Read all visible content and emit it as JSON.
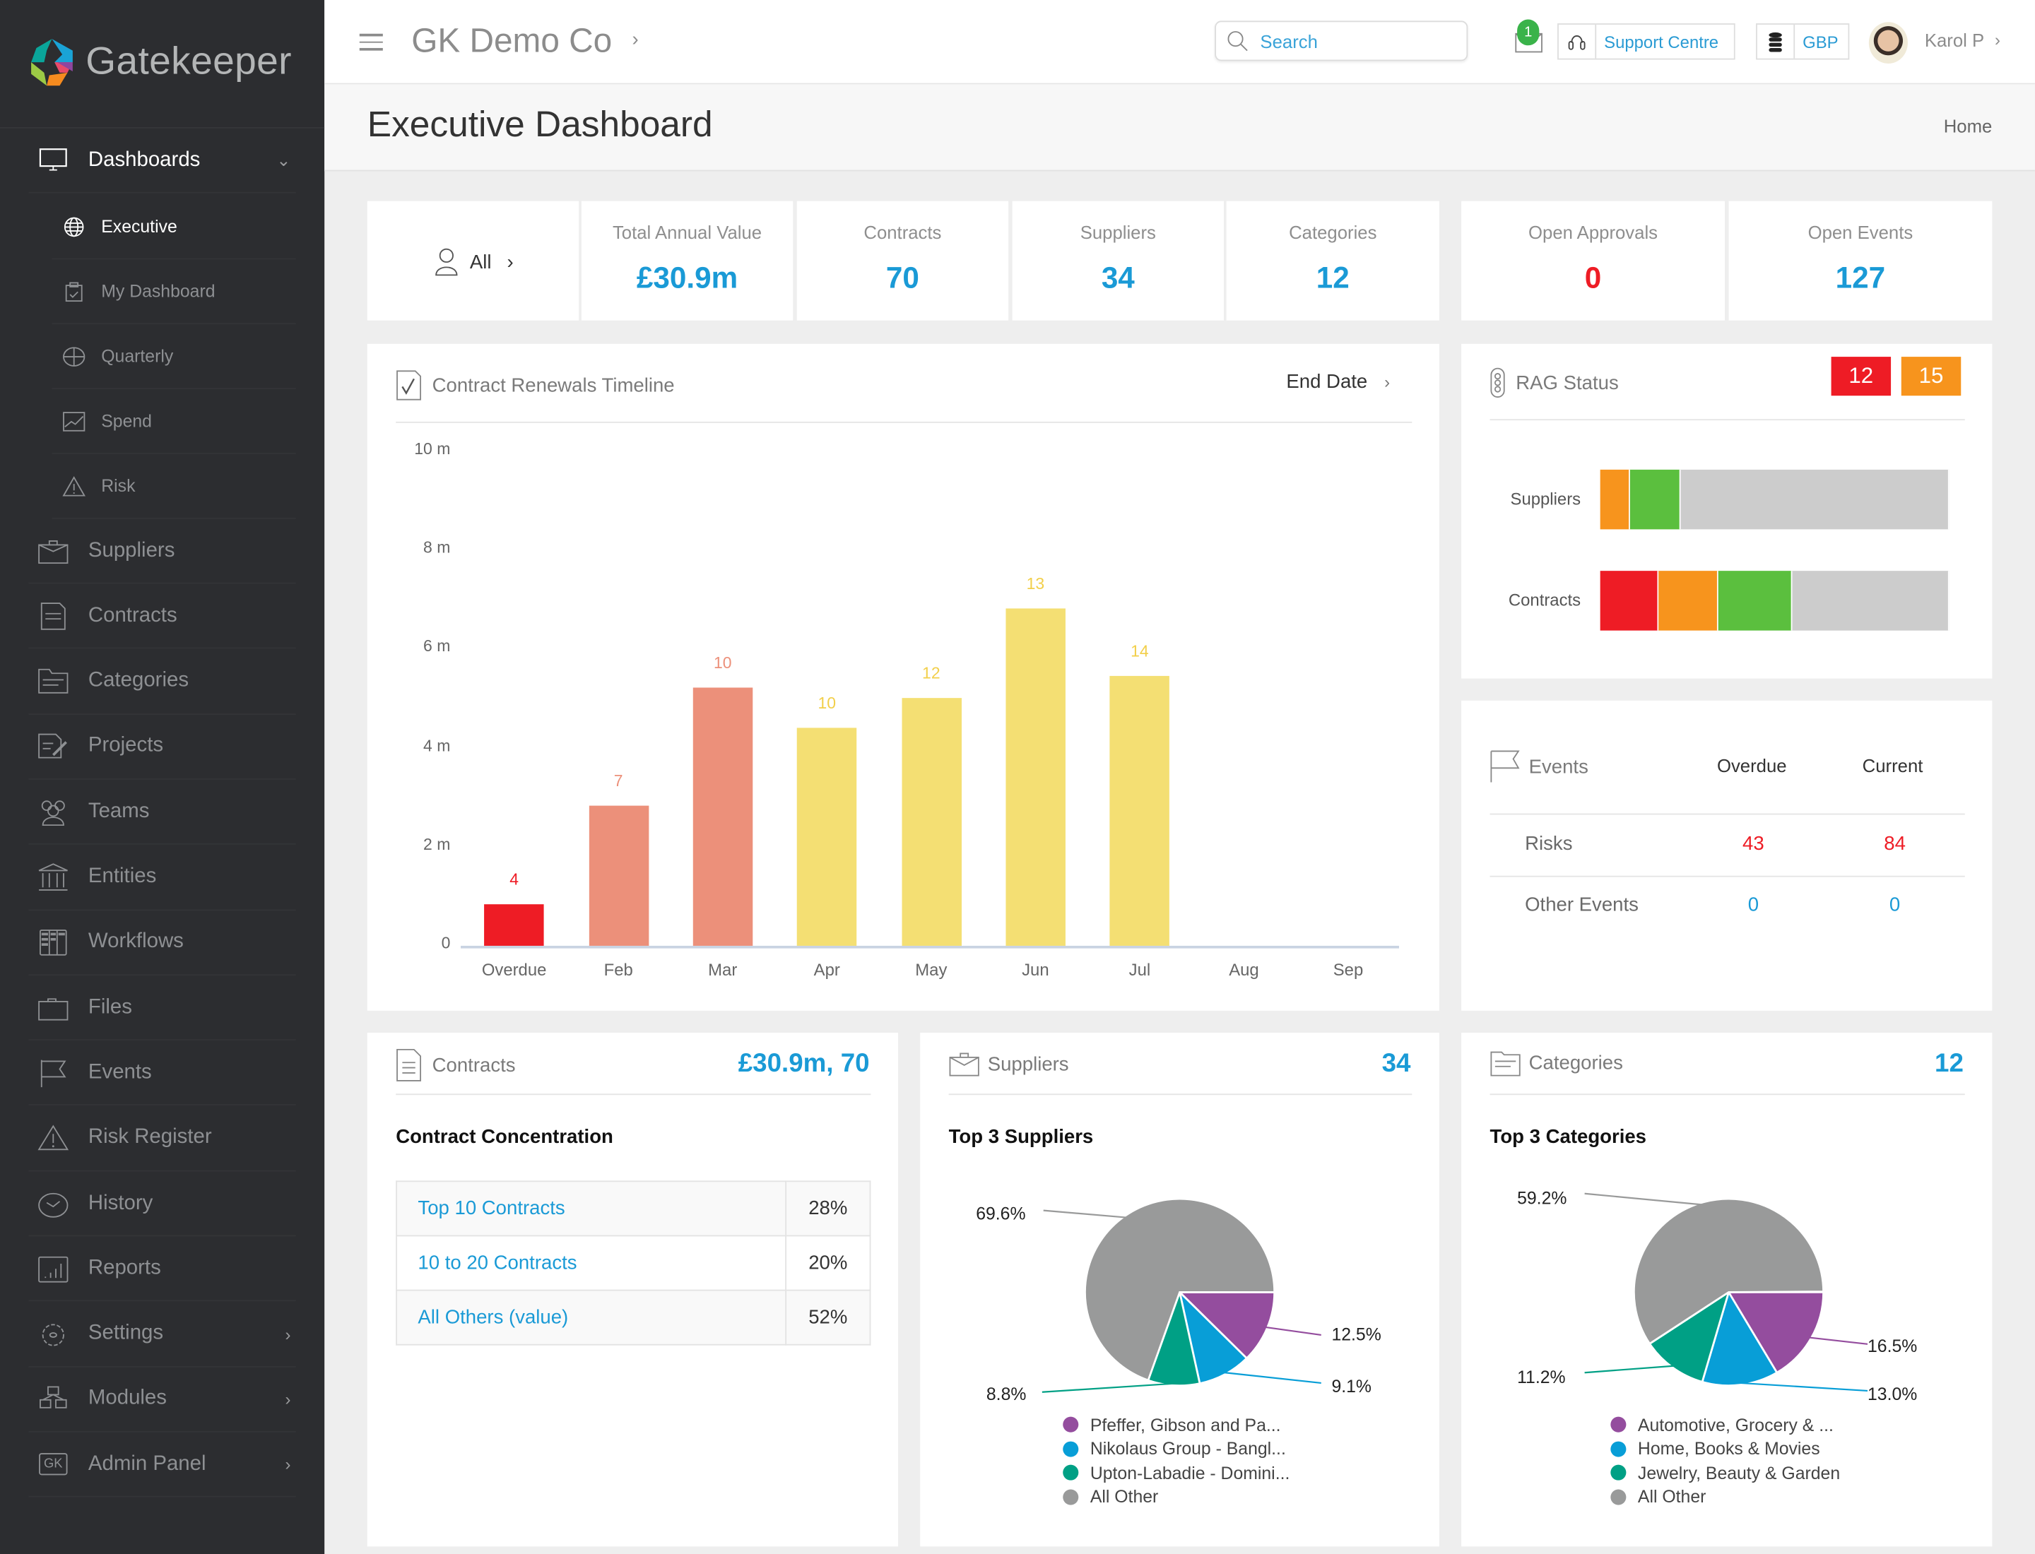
{
  "app": {
    "name": "Gatekeeper"
  },
  "sidebar": {
    "top_item": {
      "label": "Dashboards",
      "icon": "monitor-icon",
      "expanded": true
    },
    "sub_items": [
      {
        "label": "Executive",
        "icon": "globe-icon",
        "active": true
      },
      {
        "label": "My Dashboard",
        "icon": "clipboard-icon"
      },
      {
        "label": "Quarterly",
        "icon": "crosshair-icon"
      },
      {
        "label": "Spend",
        "icon": "trend-chart-icon"
      },
      {
        "label": "Risk",
        "icon": "warning-icon"
      }
    ],
    "items": [
      {
        "label": "Suppliers",
        "icon": "briefcase-icon"
      },
      {
        "label": "Contracts",
        "icon": "document-icon"
      },
      {
        "label": "Categories",
        "icon": "folder-tree-icon"
      },
      {
        "label": "Projects",
        "icon": "edit-document-icon"
      },
      {
        "label": "Teams",
        "icon": "people-icon"
      },
      {
        "label": "Entities",
        "icon": "bank-icon"
      },
      {
        "label": "Workflows",
        "icon": "kanban-icon"
      },
      {
        "label": "Files",
        "icon": "folder-icon"
      },
      {
        "label": "Events",
        "icon": "flag-icon"
      },
      {
        "label": "Risk Register",
        "icon": "warning-icon"
      },
      {
        "label": "History",
        "icon": "clock-icon"
      },
      {
        "label": "Reports",
        "icon": "bar-chart-icon"
      },
      {
        "label": "Settings",
        "icon": "gear-icon",
        "has_submenu": true
      },
      {
        "label": "Modules",
        "icon": "cubes-icon",
        "has_submenu": true
      },
      {
        "label": "Admin Panel",
        "icon": "gk-icon",
        "has_submenu": true,
        "icon_text": "GK"
      }
    ]
  },
  "topbar": {
    "company": "GK Demo Co",
    "search_placeholder": "Search",
    "mail_count": "1",
    "support_label": "Support Centre",
    "currency_label": "GBP",
    "user_name": "Karol P"
  },
  "page": {
    "title": "Executive Dashboard",
    "breadcrumb": "Home"
  },
  "kpis": {
    "filter_label": "All",
    "items": [
      {
        "label": "Total Annual Value",
        "value": "£30.9m"
      },
      {
        "label": "Contracts",
        "value": "70"
      },
      {
        "label": "Suppliers",
        "value": "34"
      },
      {
        "label": "Categories",
        "value": "12"
      },
      {
        "label": "Open Approvals",
        "value": "0",
        "color": "#ee1c25"
      },
      {
        "label": "Open Events",
        "value": "127"
      }
    ]
  },
  "renewals": {
    "title": "Contract Renewals Timeline",
    "sort_label": "End Date"
  },
  "chart_data": {
    "type": "bar",
    "title": "Contract Renewals Timeline",
    "xlabel": "",
    "ylabel": "",
    "ylim": [
      0,
      10
    ],
    "y_ticks": [
      0,
      2,
      4,
      6,
      8,
      10
    ],
    "y_tick_labels": [
      "0",
      "2 m",
      "4 m",
      "6 m",
      "8 m",
      "10 m"
    ],
    "categories": [
      "Overdue",
      "Feb",
      "Mar",
      "Apr",
      "May",
      "Jun",
      "Jul",
      "Aug",
      "Sep"
    ],
    "values": [
      0.84,
      2.83,
      5.22,
      4.41,
      5.01,
      6.82,
      5.46,
      0,
      0
    ],
    "unit": "£m",
    "data_labels": [
      "4",
      "7",
      "10",
      "10",
      "12",
      "13",
      "14",
      "",
      ""
    ],
    "colors": [
      "#ee1c25",
      "#ec907a",
      "#ec907a",
      "#f4df73",
      "#f4df73",
      "#f4df73",
      "#f4df73",
      "#f4df73",
      "#f4df73"
    ],
    "label_colors": [
      "#ee1c25",
      "#ec907a",
      "#ec907a",
      "#f2cf4a",
      "#f2cf4a",
      "#f2cf4a",
      "#f2cf4a",
      "#f2cf4a",
      "#f2cf4a"
    ],
    "grid": false
  },
  "rag": {
    "title": "RAG Status",
    "badges": [
      {
        "value": "12",
        "color": "#ee1c25"
      },
      {
        "value": "15",
        "color": "#f7941d"
      }
    ],
    "rows": [
      {
        "label": "Suppliers",
        "segments": [
          {
            "status": "amber",
            "fraction": 0.086,
            "color": "#f7941d"
          },
          {
            "status": "green",
            "fraction": 0.144,
            "color": "#5bbf3e"
          },
          {
            "status": "none",
            "fraction": 0.77,
            "color": "#cccccc"
          }
        ]
      },
      {
        "label": "Contracts",
        "segments": [
          {
            "status": "red",
            "fraction": 0.166,
            "color": "#ee1c25"
          },
          {
            "status": "amber",
            "fraction": 0.173,
            "color": "#f7941d"
          },
          {
            "status": "green",
            "fraction": 0.213,
            "color": "#5bbf3e"
          },
          {
            "status": "none",
            "fraction": 0.448,
            "color": "#cccccc"
          }
        ]
      }
    ]
  },
  "events": {
    "title": "Events",
    "col_overdue": "Overdue",
    "col_current": "Current",
    "rows": [
      {
        "label": "Risks",
        "overdue": "43",
        "current": "84",
        "color": "#ee1c25"
      },
      {
        "label": "Other Events",
        "overdue": "0",
        "current": "0",
        "color": "#1a9ad6"
      }
    ]
  },
  "contracts_card": {
    "title": "Contracts",
    "summary": "£30.9m, 70",
    "section": "Contract Concentration",
    "rows": [
      {
        "label": "Top 10 Contracts",
        "pct": "28%"
      },
      {
        "label": "10 to 20 Contracts",
        "pct": "20%"
      },
      {
        "label": "All Others (value)",
        "pct": "52%"
      }
    ]
  },
  "suppliers_card": {
    "title": "Suppliers",
    "summary": "34",
    "section": "Top 3 Suppliers",
    "pie": {
      "type": "pie",
      "slices": [
        {
          "name": "Pfeffer, Gibson and Pa...",
          "pct": 12.5,
          "label": "12.5%",
          "color": "#944d9e"
        },
        {
          "name": "Nikolaus Group - Bangl...",
          "pct": 9.1,
          "label": "9.1%",
          "color": "#089ed7"
        },
        {
          "name": "Upton-Labadie - Domini...",
          "pct": 8.8,
          "label": "8.8%",
          "color": "#00a085"
        },
        {
          "name": "All Other",
          "pct": 69.6,
          "label": "69.6%",
          "color": "#999a9a"
        }
      ]
    }
  },
  "categories_card": {
    "title": "Categories",
    "summary": "12",
    "section": "Top 3 Categories",
    "pie": {
      "type": "pie",
      "slices": [
        {
          "name": "Automotive, Grocery & ...",
          "pct": 16.5,
          "label": "16.5%",
          "color": "#944d9e"
        },
        {
          "name": "Home, Books & Movies",
          "pct": 13.0,
          "label": "13.0%",
          "color": "#089ed7"
        },
        {
          "name": "Jewelry, Beauty & Garden",
          "pct": 11.2,
          "label": "11.2%",
          "color": "#00a085"
        },
        {
          "name": "All Other",
          "pct": 59.2,
          "label": "59.2%",
          "color": "#999a9a"
        }
      ]
    }
  }
}
